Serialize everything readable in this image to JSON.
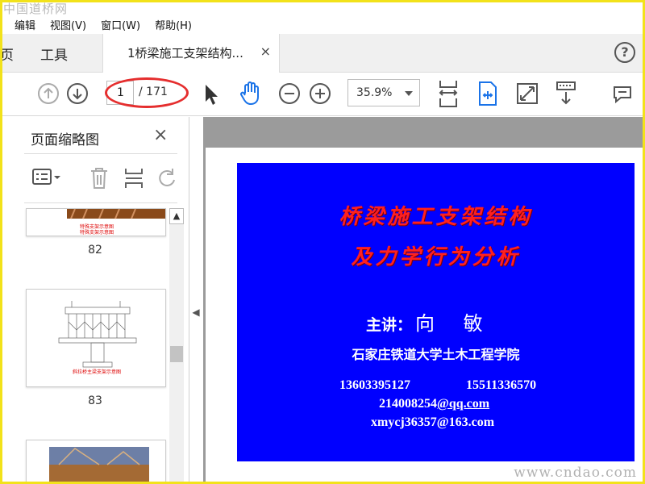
{
  "watermark_top": "中国道桥网",
  "watermark_bottom": "www.cndao.com",
  "menu": [
    "编辑",
    "视图(V)",
    "窗口(W)",
    "帮助(H)"
  ],
  "tabs": {
    "home": "页",
    "tools": "工具",
    "doc_title": "1桥梁施工支架结构...",
    "close": "×",
    "help": "?"
  },
  "toolbar": {
    "page_current": "1",
    "page_total": "/ 171",
    "zoom": "35.9%"
  },
  "sidebar": {
    "title": "页面缩略图",
    "close": "×",
    "thumbs": [
      {
        "label": "82",
        "caption": "特殊支架示意图"
      },
      {
        "label": "83",
        "caption": "斜拉桥主梁支架示意图"
      },
      {
        "label": "",
        "caption": ""
      }
    ]
  },
  "slide": {
    "title_line1": "桥梁施工支架结构",
    "title_line2": "及力学行为分析",
    "presenter_prefix": "主讲：",
    "presenter_name": "向 敏",
    "school": "石家庄铁道大学土木工程学院",
    "phone1": "13603395127",
    "phone2": "15511336570",
    "email1_user": "214008254",
    "email1_domain": "@qq.com",
    "email2": "xmycj36357@163.com"
  },
  "colors": {
    "slide_bg": "#0000ff",
    "title_red": "#ff2020",
    "accent_blue": "#1a73e8",
    "annotation_red": "#e52e2e"
  }
}
